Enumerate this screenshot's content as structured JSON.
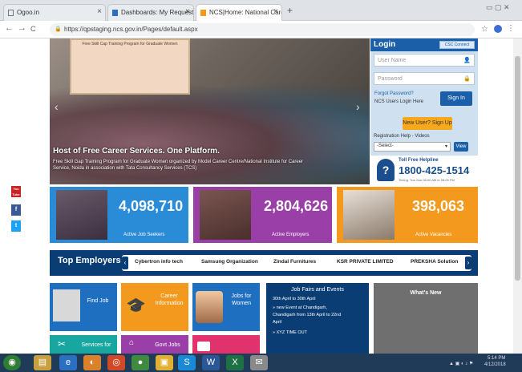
{
  "browser": {
    "tabs": [
      {
        "label": "Ogoo.in",
        "active": false
      },
      {
        "label": "Dashboards: My Requests - Mic",
        "active": false
      },
      {
        "label": "NCS|Home: National Career Serv",
        "active": true
      }
    ],
    "new_tab": "+",
    "url": "https://qpstaging.ncs.gov.in/Pages/default.aspx",
    "nav": {
      "back": "←",
      "forward": "→",
      "reload": "C"
    }
  },
  "hero": {
    "poster_text": "Free Skill Cap Training Program for Graduate Women",
    "title": "Host of Free Career Services. One Platform.",
    "description": "Free Skill Gap Training Program for Graduate Women organized by Model Career Centre/National Institute for Career Service, Noida in association with Tata Consultancy Services (TCS)"
  },
  "login": {
    "title": "Login",
    "sso_label": "CSC Connect",
    "username_placeholder": "User Name",
    "password_placeholder": "Password",
    "forgot": "Forgot Password?",
    "ncs_users": "NCS Users Login Here",
    "signin": "Sign In",
    "new_user": "New User? Sign Up",
    "reg_help": "Registration Help - Videos",
    "reg_select": "-Select-",
    "reg_view": "View",
    "helpline_label": "Toll Free Helpline",
    "helpline_number": "1800-425-1514",
    "helpline_timing": "Timing: Tue-Sun 08:00 AM to 08:00 PM"
  },
  "social": [
    "You Tube",
    "f",
    "t"
  ],
  "stats": [
    {
      "value": "4,098,710",
      "label": "Active Job Seekers",
      "color": "#2a8bd6"
    },
    {
      "value": "2,804,626",
      "label": "Active Employers",
      "color": "#9b3fa8"
    },
    {
      "value": "398,063",
      "label": "Active Vacancies",
      "color": "#f39a1e"
    }
  ],
  "employers": {
    "title": "Top Employers",
    "items": [
      "Cybertron info tech",
      "Samsung Organization",
      "Zindal Furnitures",
      "KSR PRIVATE LIMITED",
      "PREKSHA Solution"
    ],
    "prev": "‹",
    "next": "›"
  },
  "tiles": [
    {
      "label": "Find Job",
      "color": "#1f6fc0"
    },
    {
      "label": "Career Information",
      "color": "#f39a1e"
    },
    {
      "label": "Jobs for Women",
      "color": "#1f6fc0"
    },
    {
      "label": "Services for",
      "color": "#17a6a0"
    },
    {
      "label": "Govt Jobs",
      "color": "#9b3fa8"
    },
    {
      "label": "",
      "color": "#e0336d"
    }
  ],
  "job_fairs": {
    "title": "Job Fairs and Events",
    "lines": [
      "30th April to 30th April",
      "» new Event at Chandigarh,",
      "Chandigarh from 13th April to 22nd",
      "April",
      "» XYZ TIME OUT"
    ]
  },
  "whats_new": {
    "title": "What's New"
  },
  "taskbar": {
    "apps": [
      "◉",
      "▤",
      "e",
      "◐",
      "◎",
      "●",
      "▣",
      "S",
      "W",
      "X",
      "✉"
    ],
    "time": "5:14 PM",
    "date": "4/12/2018"
  },
  "colors": {
    "brand": "#0a3d74",
    "accent": "#f7a81b",
    "login_bg": "#cfe0f1"
  }
}
